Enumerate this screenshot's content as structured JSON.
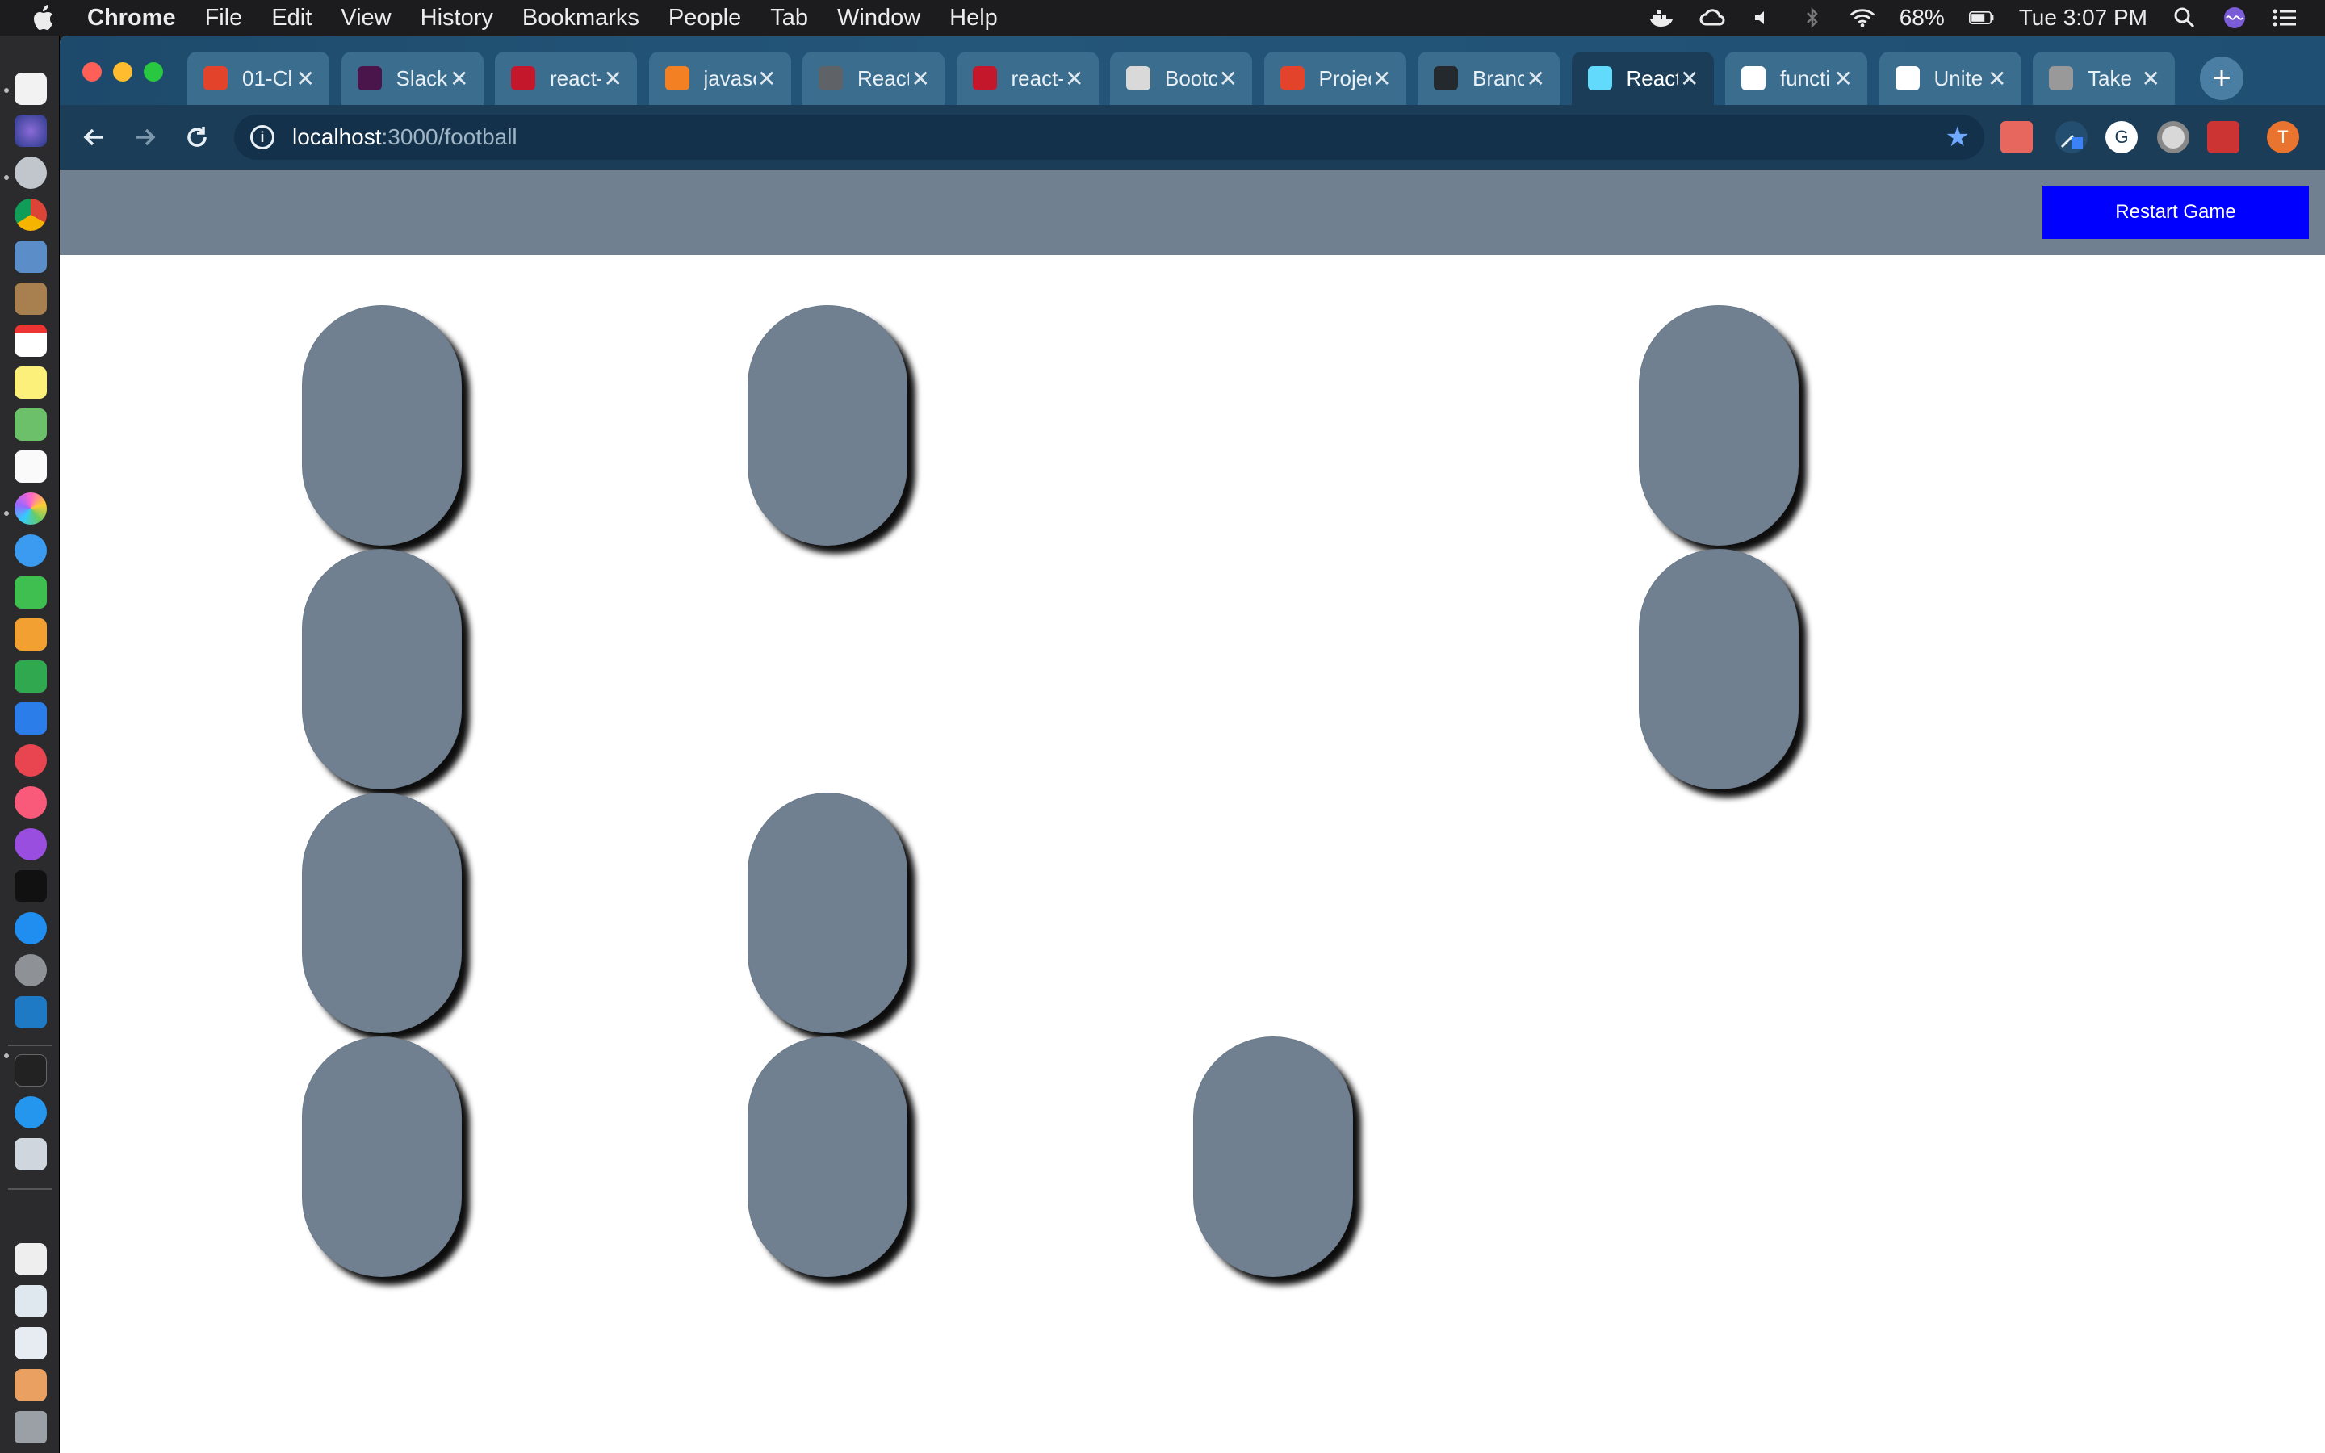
{
  "menubar": {
    "app": "Chrome",
    "items": [
      "File",
      "Edit",
      "View",
      "History",
      "Bookmarks",
      "People",
      "Tab",
      "Window",
      "Help"
    ],
    "battery": "68%",
    "clock": "Tue 3:07 PM"
  },
  "tabs": [
    {
      "title": "01-Cl",
      "icon": "gitlab-icon",
      "color": "#e2432a"
    },
    {
      "title": "Slack",
      "icon": "slack-icon",
      "color": "#4a154b"
    },
    {
      "title": "react-",
      "icon": "pluralsight-icon",
      "color": "#c4172c"
    },
    {
      "title": "javasc",
      "icon": "stackoverflow-icon",
      "color": "#f48024"
    },
    {
      "title": "React",
      "icon": "globe-icon",
      "color": "#5f6368"
    },
    {
      "title": "react-",
      "icon": "pluralsight-icon",
      "color": "#c4172c"
    },
    {
      "title": "Bootc",
      "icon": "bootcamp-icon",
      "color": "#d9d9d9"
    },
    {
      "title": "Projec",
      "icon": "gitlab-icon",
      "color": "#e2432a"
    },
    {
      "title": "Branc",
      "icon": "github-icon",
      "color": "#24292e"
    },
    {
      "title": "React",
      "icon": "react-icon",
      "color": "#61dafb",
      "active": true
    },
    {
      "title": "functi",
      "icon": "google-icon",
      "color": "#ffffff"
    },
    {
      "title": "Unite",
      "icon": "notion-icon",
      "color": "#ffffff"
    },
    {
      "title": "Take",
      "icon": "apple-icon",
      "color": "#999999"
    }
  ],
  "address": {
    "host": "localhost",
    "path": ":3000/football"
  },
  "profile_initial": "T",
  "game": {
    "restart_label": "Restart Game",
    "grid_columns": 4,
    "grid_rows": 4,
    "cells": [
      [
        true,
        true,
        false,
        true
      ],
      [
        true,
        false,
        false,
        true
      ],
      [
        true,
        true,
        false,
        false
      ],
      [
        true,
        true,
        true,
        false
      ]
    ],
    "pill_color": "#708090",
    "header_color": "#708090",
    "button_color": "#0000ff"
  }
}
